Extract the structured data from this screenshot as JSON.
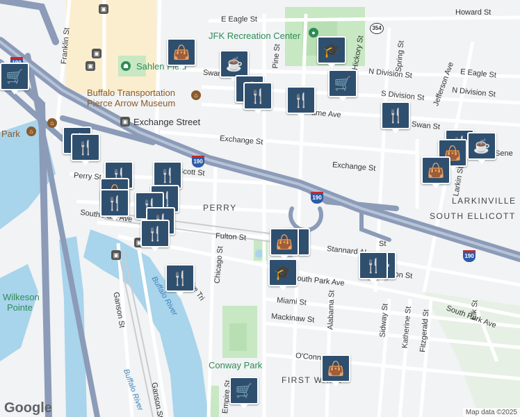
{
  "map": {
    "neighborhoods": [
      "PERRY",
      "LARKINVILLE",
      "SOUTH ELLICOTT",
      "FIRST WARD"
    ],
    "pois": {
      "jfk": "JFK Recreation Center",
      "sahlen": "Sahlen Field",
      "museum_line1": "Buffalo Transportation",
      "museum_line2": "Pierce Arrow Museum",
      "station": "Exchange Street",
      "conway": "Conway Park",
      "wilkeson_line1": "Wilkeson",
      "wilkeson_line2": "Pointe",
      "park": "Park"
    },
    "streets": {
      "e_eagle": "E Eagle St",
      "howard": "Howard St",
      "swan": "Swan St",
      "swan2": "Swan St",
      "n_division": "N Division St",
      "s_division": "S Division St",
      "n_division2": "N Division St",
      "e_eagle2": "E Eagle St",
      "exchange": "Exchange St",
      "exchange2": "Exchange St",
      "scott": "Scott St",
      "perry": "Perry St",
      "fulton": "Fulton St",
      "fulton2": "Fulton St",
      "stannard": "Stannard Al",
      "south_park": "South Park Ave",
      "south_park2": "South Park Ave",
      "south_park3": "South Park Ave",
      "miami": "Miami St",
      "mackinaw": "Mackinaw St",
      "oconnell": "O'Connell",
      "chicago": "Chicago St",
      "empire": "Empire St",
      "ganson": "Ganson St",
      "ganson2": "Ganson St",
      "alabama": "Alabama St",
      "sidway": "Sidway St",
      "katherine": "Katherine St",
      "fitzgerald": "Fitzgerald St",
      "elk": "Elk St",
      "larkin": "Larkin St",
      "jefferson": "Jefferson Ave",
      "spring": "Spring St",
      "hickory": "Hickory St",
      "pine": "Pine St",
      "franklin": "Franklin St",
      "seneca": "Sene",
      "emp_tri": "Empire Tri",
      "ame": "ame Ave",
      "lton": "lton St",
      "lrkst": "St"
    },
    "water": {
      "buffalo_river": "Buffalo River",
      "buffalo_river2": "Buffalo River"
    },
    "shields": {
      "i190": "190",
      "r354": "354"
    },
    "attribution": "Map data ©2025",
    "logo": "Google"
  }
}
